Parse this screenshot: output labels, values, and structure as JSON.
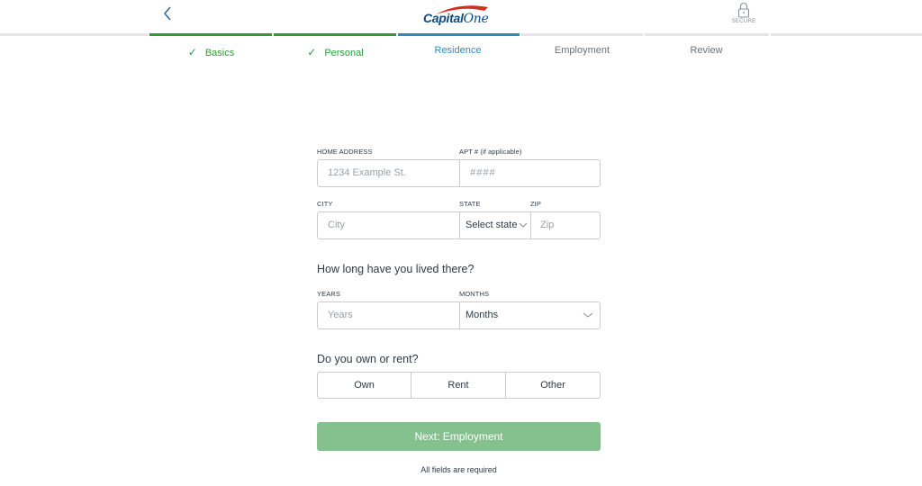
{
  "header": {
    "back_icon": "chevron-left-icon",
    "logo_text_bold": "Capital",
    "logo_text_script": "One",
    "secure_label": "SECURE",
    "secure_icon": "lock-icon"
  },
  "colors": {
    "complete": "#2a9d3a",
    "active": "#2b8cc4",
    "inactive_text": "#6b7178",
    "track": "#e6e6e8",
    "next_button": "#85c18e"
  },
  "steps": [
    {
      "label": "Basics",
      "status": "complete",
      "check": "✓"
    },
    {
      "label": "Personal",
      "status": "complete",
      "check": "✓"
    },
    {
      "label": "Residence",
      "status": "active",
      "check": ""
    },
    {
      "label": "Employment",
      "status": "upcoming",
      "check": ""
    },
    {
      "label": "Review",
      "status": "upcoming",
      "check": ""
    }
  ],
  "form": {
    "home_address": {
      "label": "HOME ADDRESS",
      "placeholder": "1234 Example St.",
      "value": ""
    },
    "apt": {
      "label": "APT # (if applicable)",
      "placeholder": "####",
      "value": ""
    },
    "city": {
      "label": "CITY",
      "placeholder": "City",
      "value": ""
    },
    "state": {
      "label": "STATE",
      "selected": "Select state"
    },
    "zip": {
      "label": "ZIP",
      "placeholder": "Zip",
      "value": ""
    },
    "duration_question": "How long have you lived there?",
    "years": {
      "label": "YEARS",
      "placeholder": "Years",
      "value": ""
    },
    "months": {
      "label": "MONTHS",
      "selected": "Months"
    },
    "own_rent_question": "Do you own or rent?",
    "own_rent_options": [
      "Own",
      "Rent",
      "Other"
    ],
    "next_button": "Next: Employment",
    "required_note": "All fields are required"
  }
}
